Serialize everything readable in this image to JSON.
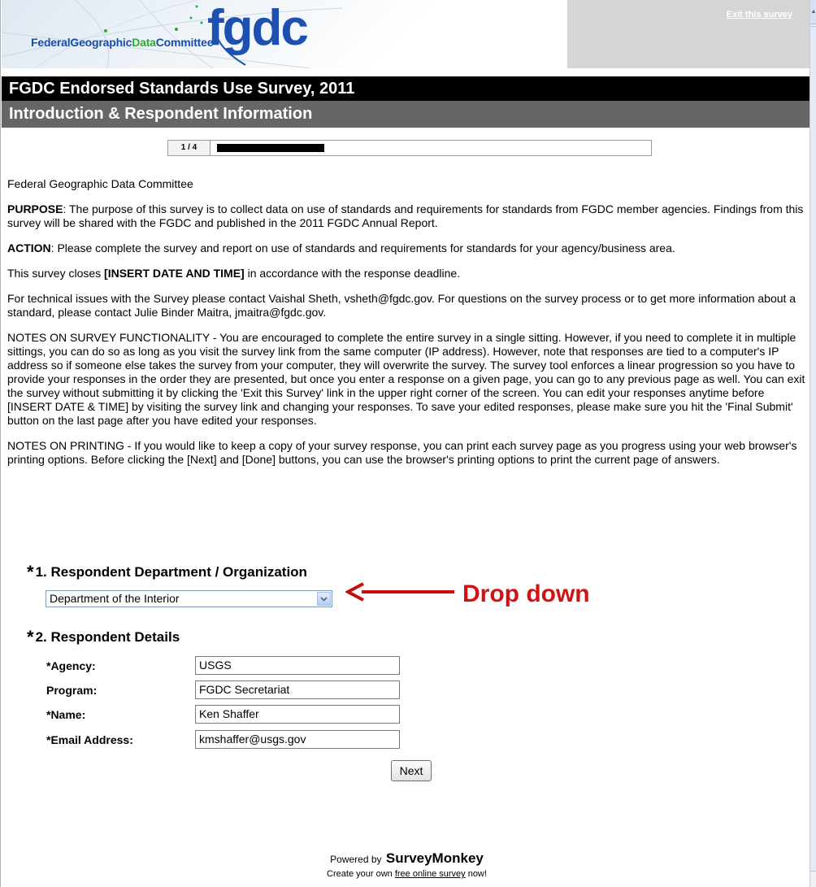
{
  "header": {
    "logo_text_primary": "FederalGeographic",
    "logo_text_highlight": "Data",
    "logo_text_secondary": "Committee",
    "logo_mark": "fgdc",
    "exit_link": "Exit this survey"
  },
  "survey": {
    "title": "FGDC Endorsed Standards Use Survey, 2011",
    "section_title": "Introduction & Respondent Information",
    "progress_label": "1 / 4",
    "progress_fraction": 0.25
  },
  "intro": {
    "org": "Federal Geographic Data Committee",
    "purpose_label": "PURPOSE",
    "purpose_text": ": The purpose of this survey is to collect data on use of standards and requirements for standards from FGDC member agencies. Findings from this survey will be shared with the FGDC and published in the 2011 FGDC Annual Report.",
    "action_label": "ACTION",
    "action_text": ": Please complete the survey and report on use of standards and requirements for standards for your agency/business area.",
    "closes_pre": "This survey closes ",
    "closes_bold": "[INSERT DATE AND TIME]",
    "closes_post": " in accordance with the response deadline.",
    "contact": "For technical issues with the Survey please contact Vaishal Sheth, vsheth@fgdc.gov. For questions on the survey process or to get more information about a standard, please contact Julie Binder Maitra, jmaitra@fgdc.gov.",
    "notes_functionality": "NOTES ON SURVEY FUNCTIONALITY - You are encouraged to complete the entire survey in a single sitting. However, if you need to complete it in multiple sittings, you can do so as long as you visit the survey link from the same computer (IP address). However, note that responses are tied to a computer's IP address so if someone else takes the survey from your computer, they will overwrite the survey. The survey tool enforces a linear progression so you have to provide your responses in the order they are presented, but once you enter a response on a given page, you can go to any previous page as well. You can exit the survey without submitting it by clicking the 'Exit this Survey' link in the upper right corner of the screen. You can edit your responses anytime before [INSERT DATE & TIME] by visiting the survey link and changing your responses. To save your edited responses, please make sure you hit the 'Final Submit' button on the last page after you have edited your responses.",
    "notes_printing": "NOTES ON PRINTING - If you would like to keep a copy of your survey response, you can print each survey page as you progress using your web browser's printing options. Before clicking the [Next] and [Done] buttons, you can use the browser's printing options to print the current page of answers."
  },
  "questions": {
    "required_mark": "*",
    "q1_title": "1. Respondent Department / Organization",
    "q1_selected": "Department of the Interior",
    "q2_title": "2. Respondent Details",
    "fields": [
      {
        "label": "*Agency:",
        "value": "USGS"
      },
      {
        "label": "Program:",
        "value": "FGDC Secretariat"
      },
      {
        "label": "*Name:",
        "value": "Ken Shaffer"
      },
      {
        "label": "*Email Address:",
        "value": "kmshaffer@usgs.gov"
      }
    ]
  },
  "annotation": {
    "text": "Drop down",
    "color": "#d11313"
  },
  "buttons": {
    "next": "Next"
  },
  "footer": {
    "powered_by": "Powered by",
    "brand": "SurveyMonkey",
    "create_pre": "Create your own ",
    "create_link": "free online survey",
    "create_post": " now!"
  }
}
